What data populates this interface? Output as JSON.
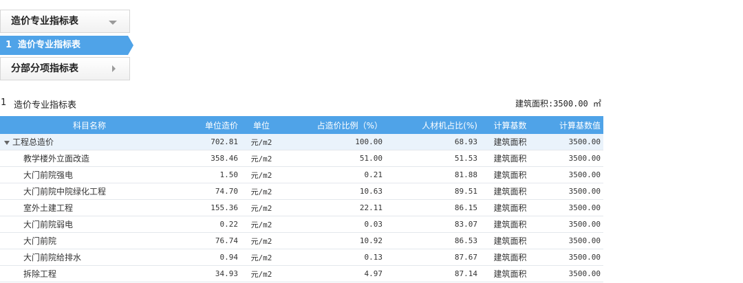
{
  "nav": {
    "header_label": "造价专业指标表",
    "active_item": {
      "index": "1",
      "label": "造价专业指标表"
    },
    "second_item_label": "分部分项指标表"
  },
  "caption": {
    "index": "1",
    "title": "造价专业指标表",
    "area_label": "建筑面积:3500.00 ㎡"
  },
  "table": {
    "headers": [
      "科目名称",
      "单位造价",
      "单位",
      "占造价比例（%）",
      "人材机占比(%)",
      "计算基数",
      "计算基数值"
    ],
    "total_row": [
      "工程总造价",
      "702.81",
      "元/m2",
      "100.00",
      "68.93",
      "建筑面积",
      "3500.00"
    ],
    "rows": [
      [
        "教学楼外立面改造",
        "358.46",
        "元/m2",
        "51.00",
        "51.53",
        "建筑面积",
        "3500.00"
      ],
      [
        "大门前院强电",
        "1.50",
        "元/m2",
        "0.21",
        "81.88",
        "建筑面积",
        "3500.00"
      ],
      [
        "大门前院中院绿化工程",
        "74.70",
        "元/m2",
        "10.63",
        "89.51",
        "建筑面积",
        "3500.00"
      ],
      [
        "室外土建工程",
        "155.36",
        "元/m2",
        "22.11",
        "86.15",
        "建筑面积",
        "3500.00"
      ],
      [
        "大门前院弱电",
        "0.22",
        "元/m2",
        "0.03",
        "83.07",
        "建筑面积",
        "3500.00"
      ],
      [
        "大门前院",
        "76.74",
        "元/m2",
        "10.92",
        "86.53",
        "建筑面积",
        "3500.00"
      ],
      [
        "大门前院给排水",
        "0.94",
        "元/m2",
        "0.13",
        "87.67",
        "建筑面积",
        "3500.00"
      ],
      [
        "拆除工程",
        "34.93",
        "元/m2",
        "4.97",
        "87.14",
        "建筑面积",
        "3500.00"
      ]
    ]
  },
  "colors": {
    "accent": "#4fa3e8",
    "total_row_bg": "#eaf3fb"
  }
}
